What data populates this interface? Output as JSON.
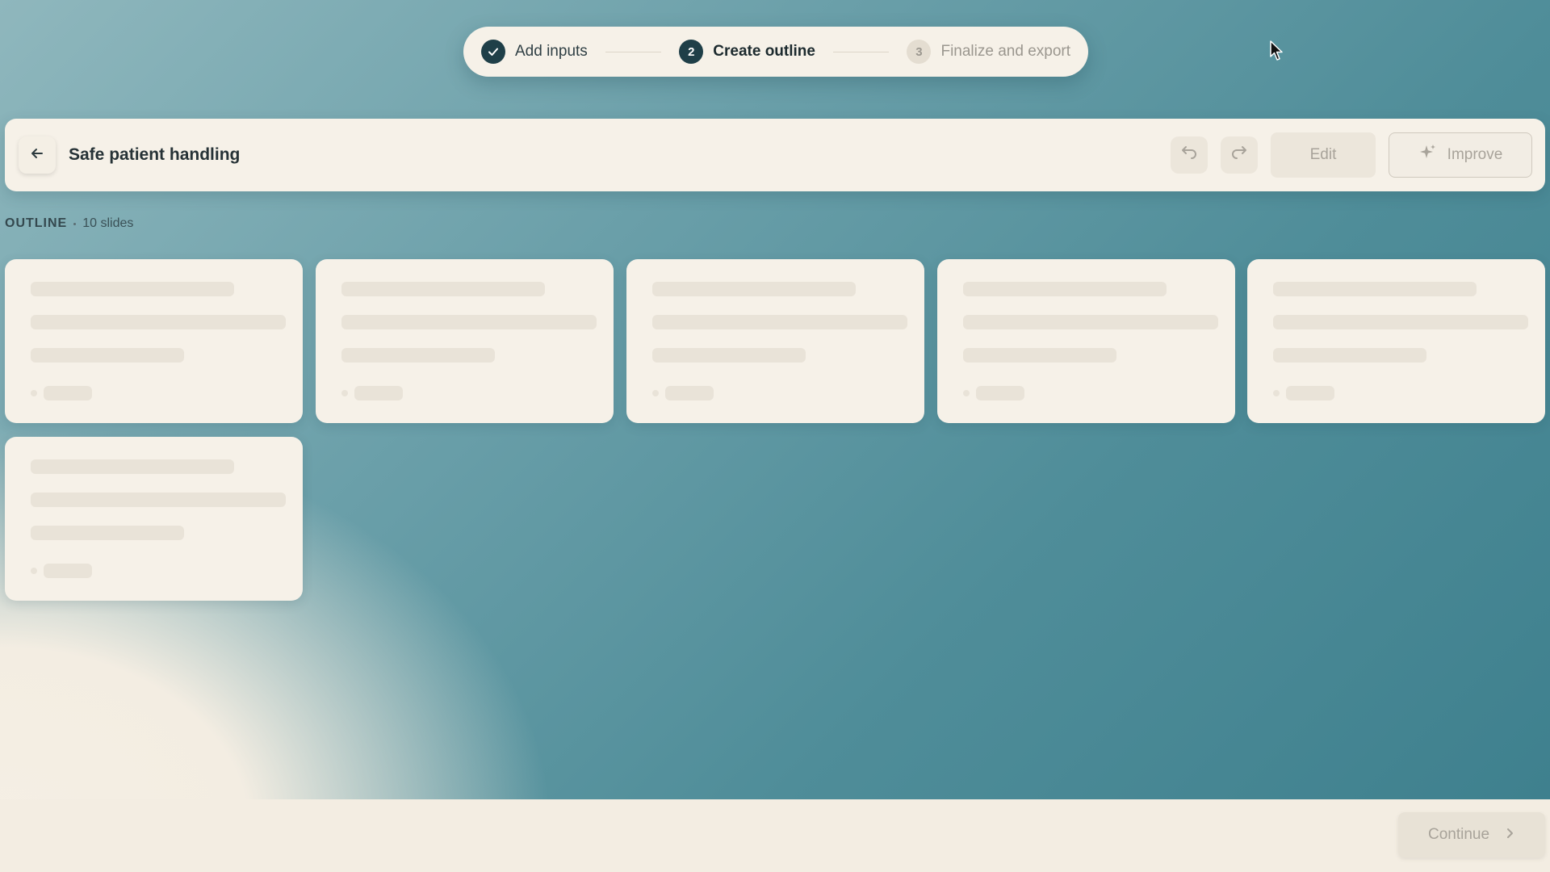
{
  "stepper": {
    "steps": [
      {
        "number": "",
        "label": "Add inputs",
        "state": "done"
      },
      {
        "number": "2",
        "label": "Create outline",
        "state": "active"
      },
      {
        "number": "3",
        "label": "Finalize and export",
        "state": "todo"
      }
    ]
  },
  "header": {
    "title": "Safe patient handling",
    "edit_label": "Edit",
    "improve_label": "Improve"
  },
  "outline": {
    "label": "OUTLINE",
    "count": "10 slides",
    "cards_loading": 6
  },
  "footer": {
    "continue_label": "Continue"
  },
  "icons": {
    "back": "arrow-left-icon",
    "undo": "undo-icon",
    "redo": "redo-icon",
    "improve": "sparkle-icon",
    "continue": "chevron-right-icon",
    "step_done": "check-icon"
  },
  "colors": {
    "accent_dark": "#1f3f48",
    "panel": "#f6f1e8",
    "background_teal": "#4f8d99",
    "background_cream": "#f3ede2"
  }
}
